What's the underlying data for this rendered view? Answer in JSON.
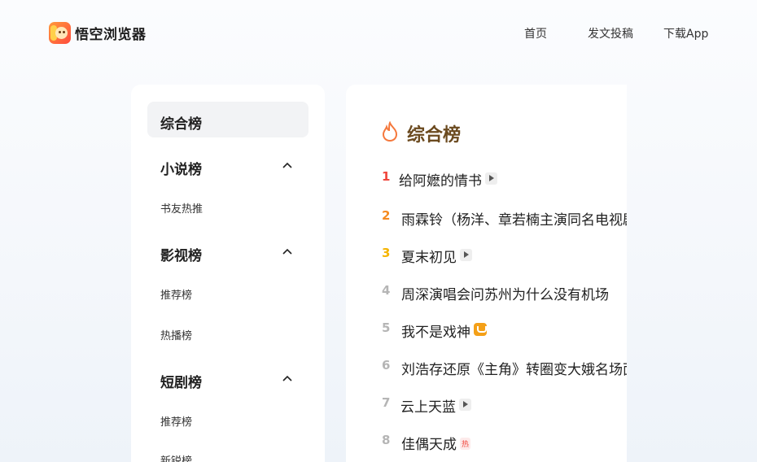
{
  "header": {
    "brand": "悟空浏览器",
    "nav": [
      "首页",
      "发文投稿",
      "下载App"
    ]
  },
  "sidebar": {
    "active": "综合榜",
    "groups": [
      {
        "label": "小说榜",
        "items": [
          "书友热推"
        ]
      },
      {
        "label": "影视榜",
        "items": [
          "推荐榜",
          "热播榜"
        ]
      },
      {
        "label": "短剧榜",
        "items": [
          "推荐榜",
          "新锐榜"
        ]
      }
    ]
  },
  "main": {
    "title": "综合榜",
    "rank_colors": [
      "#f0463c",
      "#f58a1f",
      "#f5b400",
      "#b5b5b5"
    ],
    "items": [
      {
        "rank": "1",
        "title": "给阿嬷的情书",
        "badge": "play"
      },
      {
        "rank": "2",
        "title": "雨霖铃（杨洋、章若楠主演同名电视剧）",
        "badge": ""
      },
      {
        "rank": "3",
        "title": "夏末初见",
        "badge": "play"
      },
      {
        "rank": "4",
        "title": "周深演唱会问苏州为什么没有机场",
        "badge": ""
      },
      {
        "rank": "5",
        "title": "我不是戏神",
        "badge": "up"
      },
      {
        "rank": "6",
        "title": "刘浩存还原《主角》转圈变大娥名场面",
        "badge": ""
      },
      {
        "rank": "7",
        "title": "云上天蓝",
        "badge": "play"
      },
      {
        "rank": "8",
        "title": "佳偶天成",
        "badge": "hot",
        "badge_text": "热"
      }
    ]
  }
}
